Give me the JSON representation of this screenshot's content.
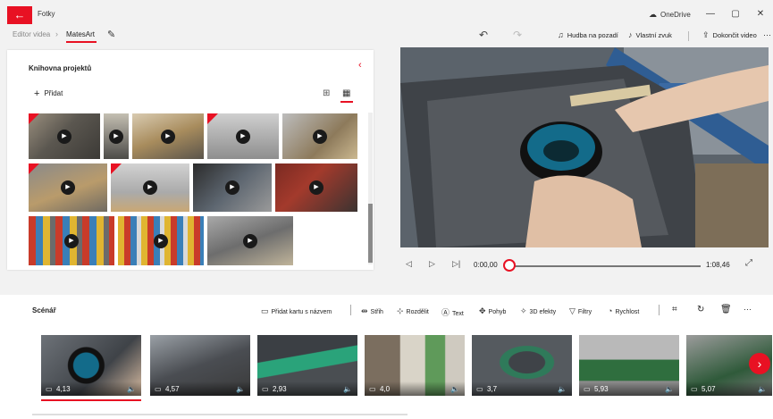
{
  "window": {
    "app_title": "Fotky",
    "onedrive_label": "OneDrive",
    "controls": [
      "—",
      "▢",
      "✕"
    ]
  },
  "breadcrumb": {
    "editor": "Editor videa",
    "separator": "›",
    "project": "MatesArt"
  },
  "toolbar": {
    "undo_icon": "↶",
    "redo_icon": "↷",
    "background_music": "Hudba na pozadí",
    "custom_audio": "Vlastní zvuk",
    "finish_video": "Dokončit video",
    "more": "···"
  },
  "library": {
    "title": "Knihovna projektů",
    "add_label": "Přidat",
    "collapse_icon": "‹"
  },
  "player": {
    "current_time": "0:00,00",
    "total_time": "1:08,46",
    "progress": 0
  },
  "storyboard": {
    "title": "Scénář",
    "actions": {
      "add_title_card": "Přidat kartu s názvem",
      "trim": "Střih",
      "split": "Rozdělit",
      "text": "Text",
      "motion": "Pohyb",
      "effects_3d": "3D efekty",
      "filters": "Filtry",
      "speed": "Rychlost"
    },
    "clips": [
      {
        "duration": "4,13"
      },
      {
        "duration": "4,57"
      },
      {
        "duration": "2,93"
      },
      {
        "duration": "4,0"
      },
      {
        "duration": "3,7"
      },
      {
        "duration": "5,93"
      },
      {
        "duration": "5,07"
      }
    ]
  },
  "colors": {
    "accent": "#e81123"
  }
}
